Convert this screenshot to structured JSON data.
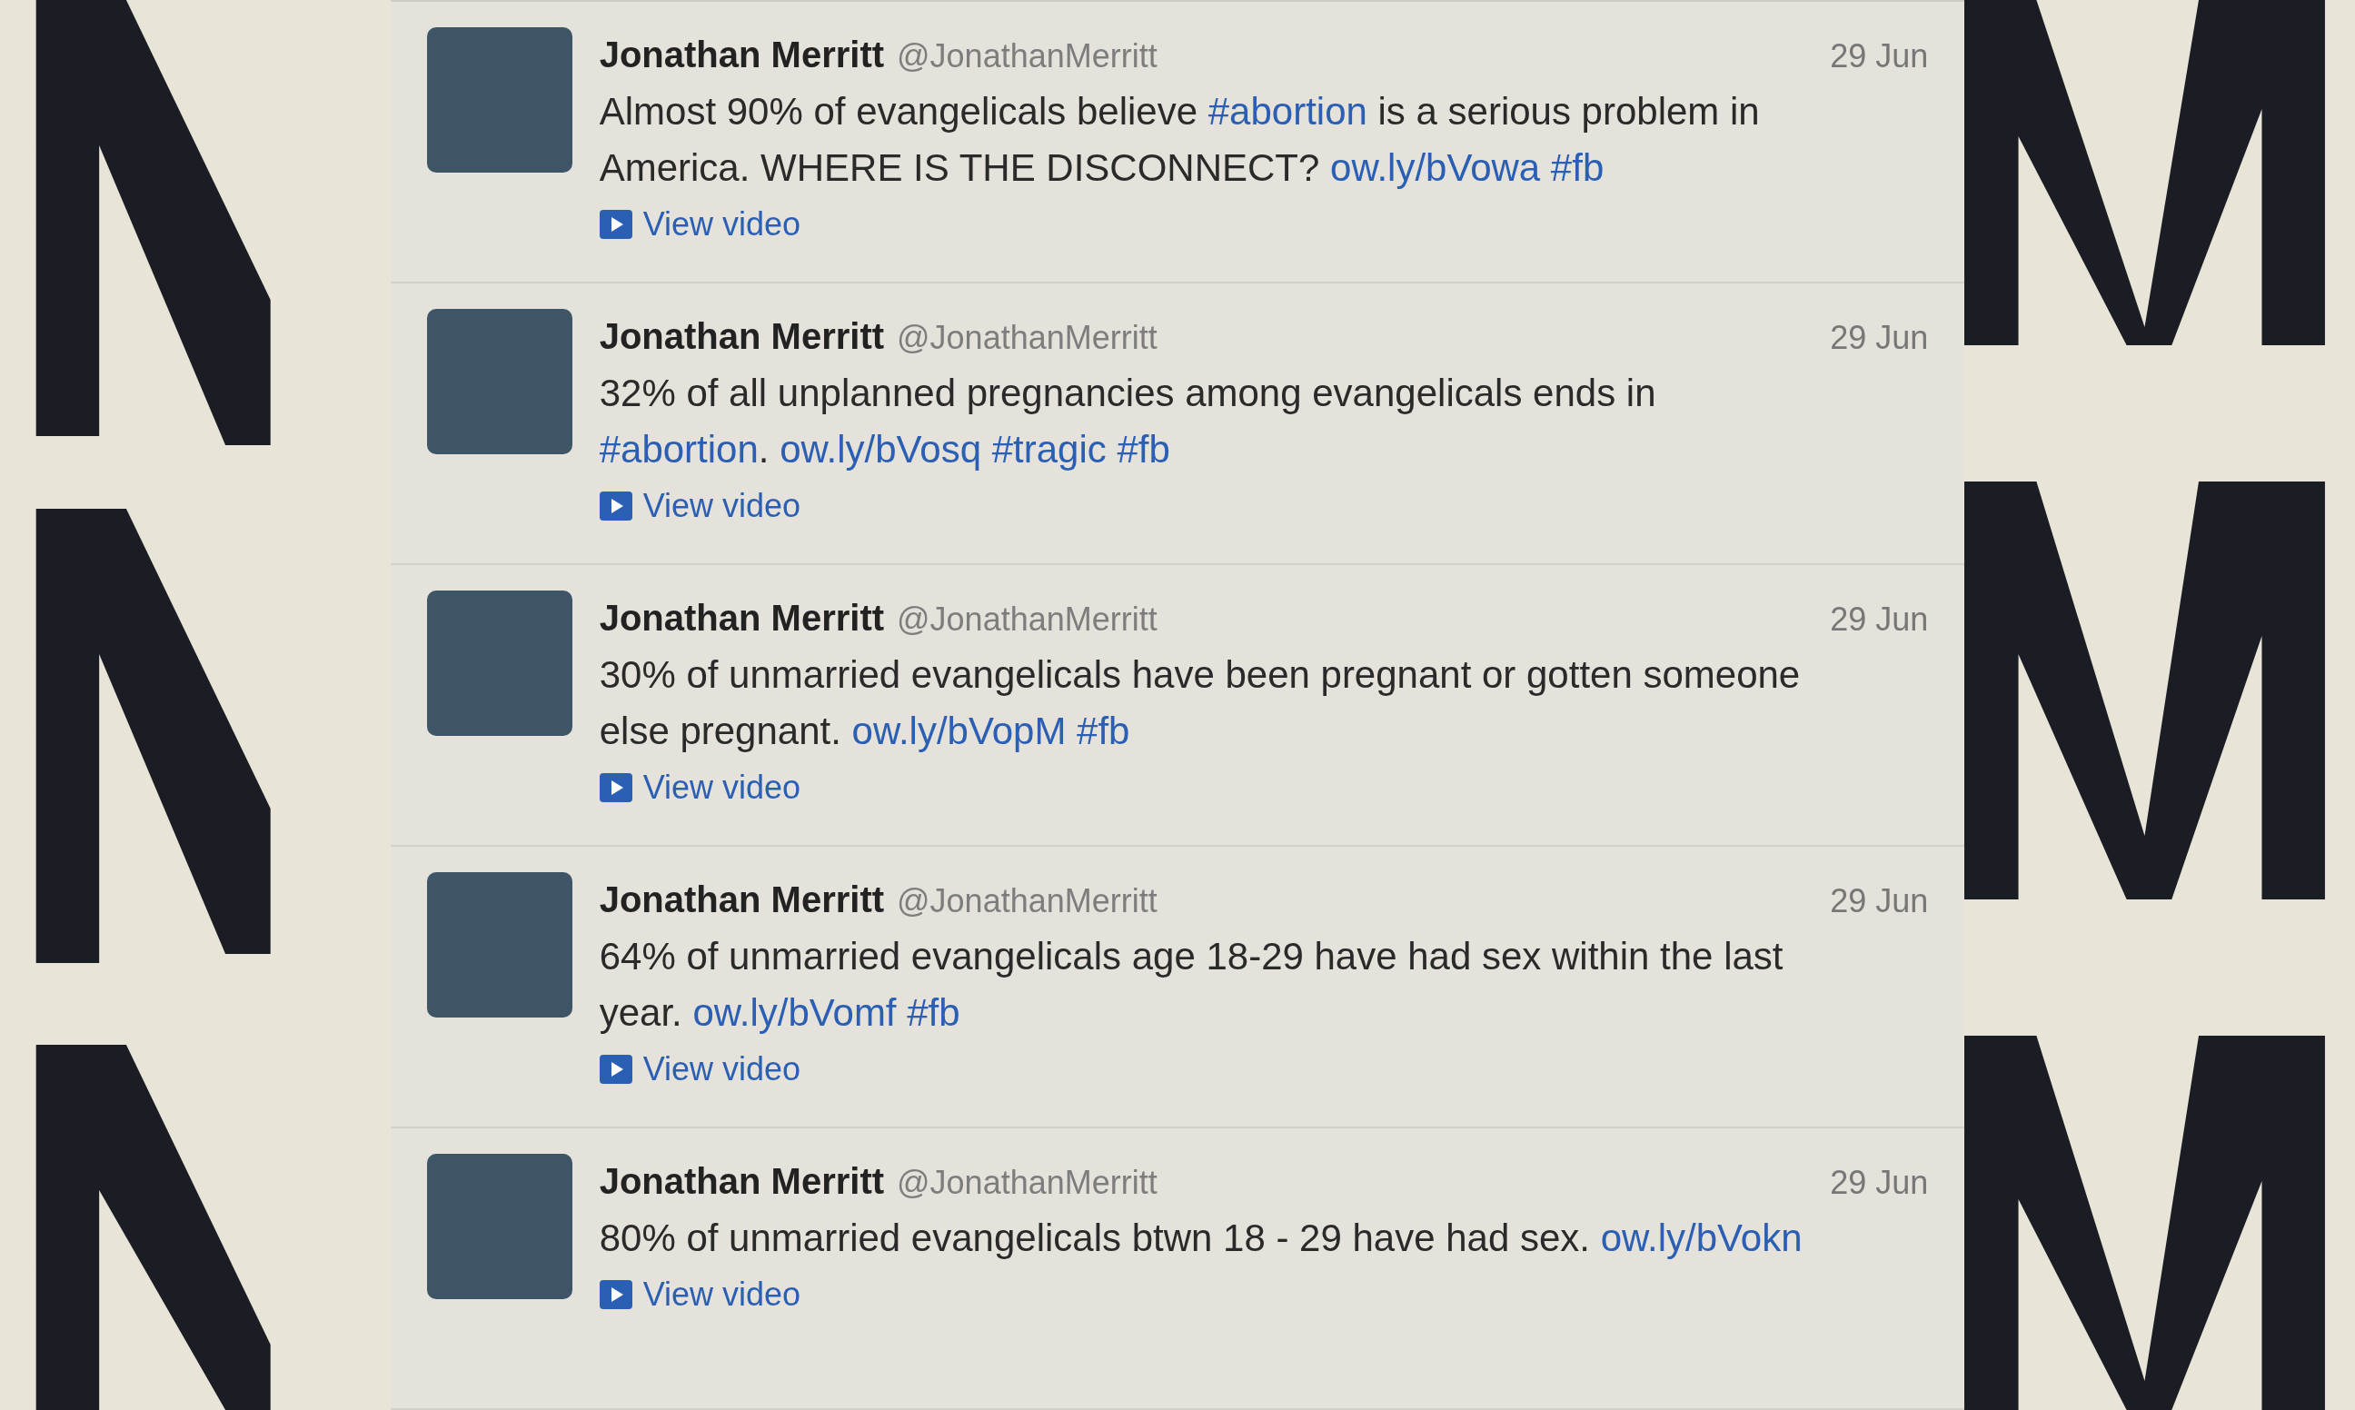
{
  "tweets": [
    {
      "name": "Jonathan Merritt",
      "handle": "@JonathanMerritt",
      "date": "29 Jun",
      "parts": [
        {
          "kind": "text",
          "text": "Almost 90% of evangelicals believe "
        },
        {
          "kind": "link",
          "text": "#abortion"
        },
        {
          "kind": "text",
          "text": " is a serious problem in America. WHERE IS THE DISCONNECT? "
        },
        {
          "kind": "link",
          "text": "ow.ly/bVowa"
        },
        {
          "kind": "link",
          "text": "#fb"
        }
      ],
      "action": "View video"
    },
    {
      "name": "Jonathan Merritt",
      "handle": "@JonathanMerritt",
      "date": "29 Jun",
      "parts": [
        {
          "kind": "text",
          "text": "32% of all unplanned pregnancies among evangelicals ends in "
        },
        {
          "kind": "link",
          "text": "#abortion"
        },
        {
          "kind": "text",
          "text": ". "
        },
        {
          "kind": "link",
          "text": "ow.ly/bVosq"
        },
        {
          "kind": "link",
          "text": "#tragic"
        },
        {
          "kind": "link",
          "text": "#fb"
        }
      ],
      "action": "View video"
    },
    {
      "name": "Jonathan Merritt",
      "handle": "@JonathanMerritt",
      "date": "29 Jun",
      "parts": [
        {
          "kind": "text",
          "text": "30% of unmarried evangelicals have been pregnant or gotten someone else pregnant. "
        },
        {
          "kind": "link",
          "text": "ow.ly/bVopM"
        },
        {
          "kind": "link",
          "text": "#fb"
        }
      ],
      "action": "View video"
    },
    {
      "name": "Jonathan Merritt",
      "handle": "@JonathanMerritt",
      "date": "29 Jun",
      "parts": [
        {
          "kind": "text",
          "text": "64% of unmarried evangelicals age 18-29 have had sex within the last year. "
        },
        {
          "kind": "link",
          "text": "ow.ly/bVomf"
        },
        {
          "kind": "link",
          "text": "#fb"
        }
      ],
      "action": "View video"
    },
    {
      "name": "Jonathan Merritt",
      "handle": "@JonathanMerritt",
      "date": "29 Jun",
      "parts": [
        {
          "kind": "text",
          "text": "80% of unmarried evangelicals btwn 18 - 29 have had sex. "
        },
        {
          "kind": "link",
          "text": "ow.ly/bVokn"
        }
      ],
      "action": "View video"
    }
  ]
}
